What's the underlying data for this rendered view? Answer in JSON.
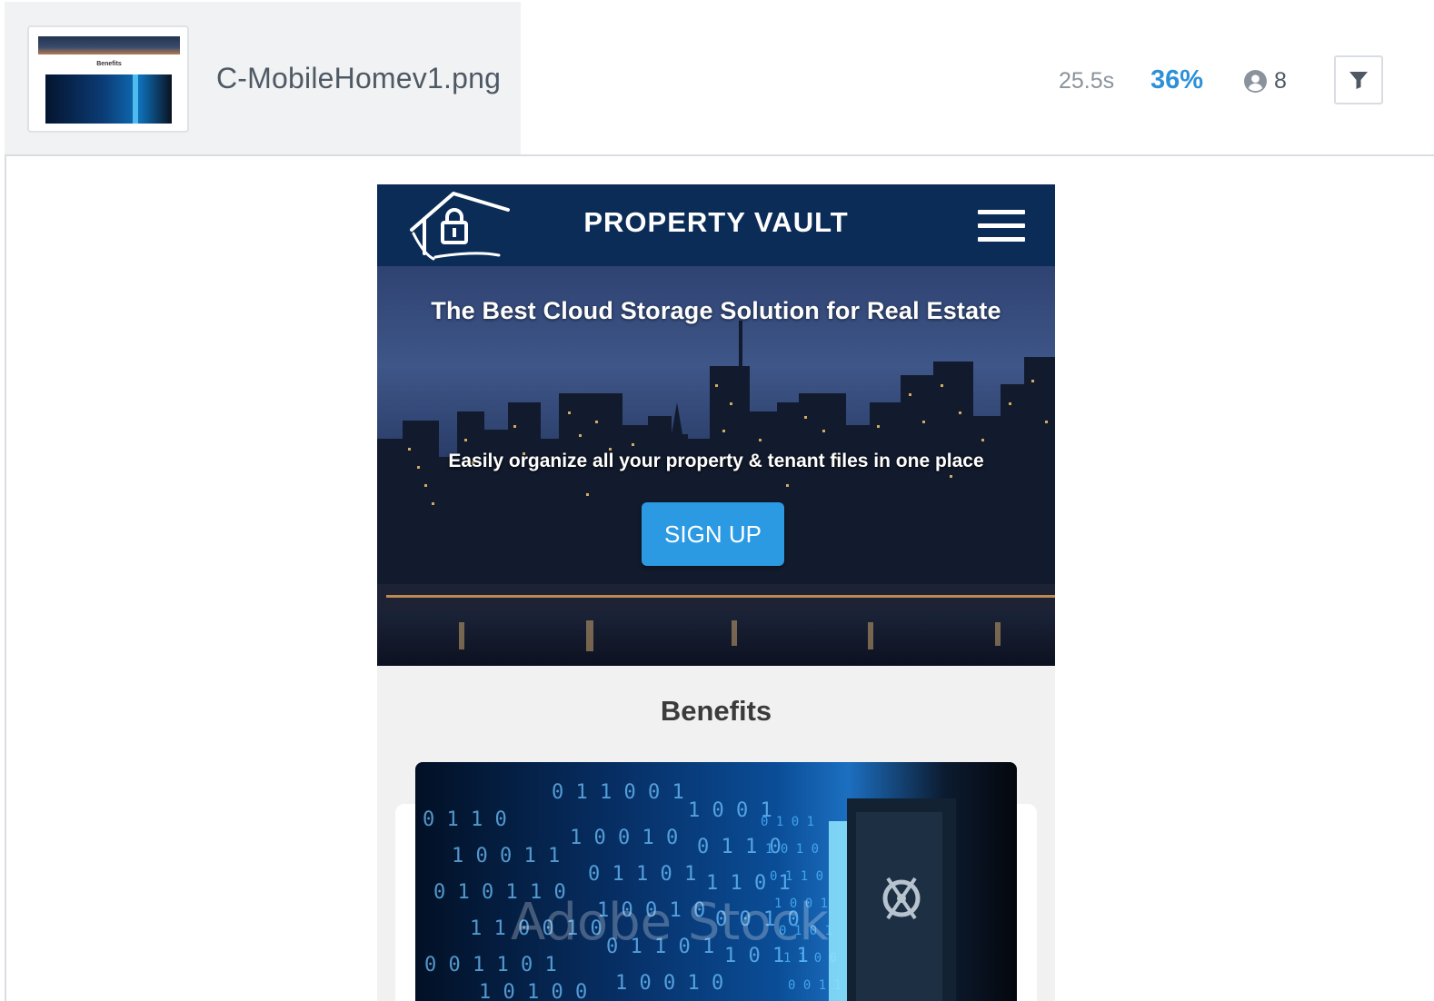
{
  "header": {
    "filename": "C-MobileHomev1.png",
    "time": "25.5s",
    "percent": "36%",
    "users_count": "8",
    "thumbnail_label": "Benefits",
    "icons": {
      "user": "user-circle-icon",
      "filter": "filter-icon"
    },
    "colors": {
      "percent": "#2d90d8",
      "muted": "#8a939c"
    }
  },
  "mock": {
    "brand": "PROPERTY VAULT",
    "hero_title": "The Best Cloud Storage Solution for Real Estate",
    "hero_subtitle": "Easily organize all your property & tenant files in one place",
    "signup_label": "SIGN UP",
    "benefits_heading": "Benefits",
    "watermark": "Adobe Stock",
    "colors": {
      "navbar": "#0b2c57",
      "button": "#2b9ae3"
    }
  }
}
